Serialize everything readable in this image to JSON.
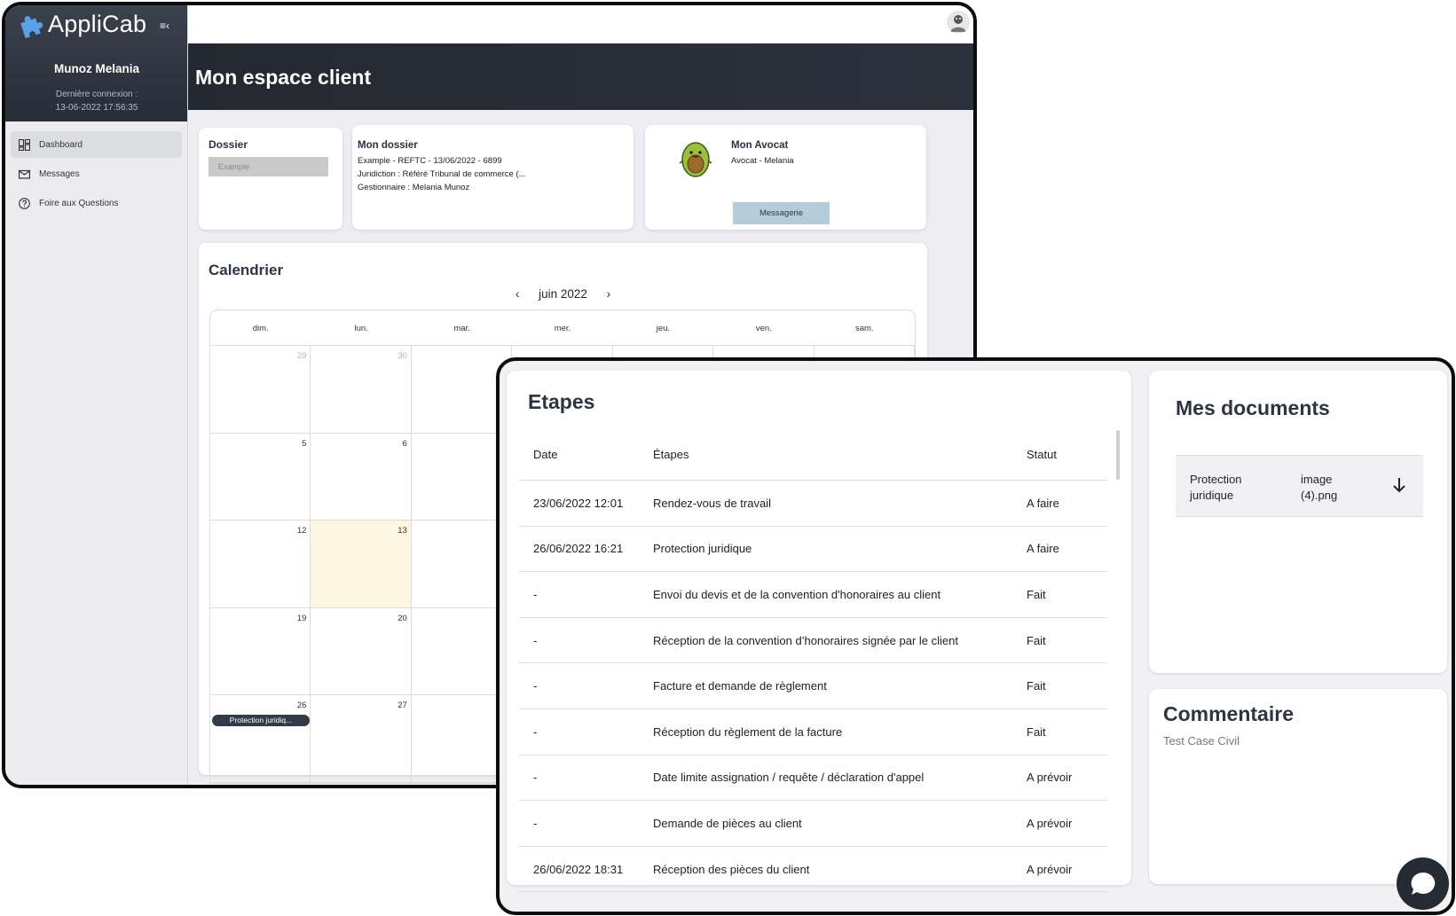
{
  "app": {
    "name": "AppliCab"
  },
  "user": {
    "name": "Munoz Melania",
    "last_login_label": "Dernière connexion :",
    "last_login_value": "13-06-2022 17:56:35"
  },
  "nav": {
    "items": [
      {
        "label": "Dashboard",
        "icon": "dashboard-icon",
        "active": true
      },
      {
        "label": "Messages",
        "icon": "mail-icon",
        "active": false
      },
      {
        "label": "Foire aux Questions",
        "icon": "help-circle-icon",
        "active": false
      }
    ]
  },
  "header": {
    "title": "Mon espace client"
  },
  "dossier": {
    "title": "Dossier",
    "selected": "Example"
  },
  "mon_dossier": {
    "title": "Mon dossier",
    "line1": "Example - REFTC - 13/06/2022 - 6899",
    "line2": "Juridiction : Référé Tribunal de commerce (...",
    "line3": "Gestionnaire : Melania Munoz"
  },
  "avocat": {
    "title": "Mon Avocat",
    "name": "Avocat - Melania",
    "button": "Messagerie"
  },
  "calendar": {
    "title": "Calendrier",
    "month": "juin 2022",
    "prev": "‹",
    "next": "›",
    "days": [
      "dim.",
      "lun.",
      "mar.",
      "mer.",
      "jeu.",
      "ven.",
      "sam."
    ],
    "weeks": [
      [
        "29",
        "30",
        "",
        "",
        "",
        "",
        ""
      ],
      [
        "5",
        "6",
        "",
        "",
        "",
        "",
        ""
      ],
      [
        "12",
        "13",
        "",
        "",
        "",
        "",
        ""
      ],
      [
        "19",
        "20",
        "",
        "",
        "",
        "",
        ""
      ],
      [
        "26",
        "27",
        "",
        "",
        "",
        "",
        ""
      ]
    ],
    "event": "Protection juridiq..."
  },
  "etapes": {
    "title": "Etapes",
    "columns": [
      "Date",
      "Étapes",
      "Statut"
    ],
    "rows": [
      [
        "23/06/2022 12:01",
        "Rendez-vous de travail",
        "A faire"
      ],
      [
        "26/06/2022 16:21",
        "Protection juridique",
        "A faire"
      ],
      [
        "-",
        "Envoi du devis et de la convention d'honoraires au client",
        "Fait"
      ],
      [
        "-",
        "Réception de la convention d’honoraires signée par le client",
        "Fait"
      ],
      [
        "-",
        "Facture et demande de règlement",
        "Fait"
      ],
      [
        "-",
        "Réception du règlement de la facture",
        "Fait"
      ],
      [
        "-",
        "Date limite assignation / requête / déclaration d'appel",
        "A prévoir"
      ],
      [
        "-",
        "Demande de pièces au client",
        "A prévoir"
      ],
      [
        "26/06/2022 18:31",
        "Réception des pièces du client",
        "A prévoir"
      ]
    ]
  },
  "documents": {
    "title": "Mes documents",
    "items": [
      {
        "name": "Protection juridique",
        "file": "image (4).png"
      }
    ]
  },
  "commentaire": {
    "title": "Commentaire",
    "text": "Test Case Civil"
  },
  "colors": {
    "sidebar_header": "#2b313a",
    "header_band": "#272d35",
    "accent_button": "#b4cdd9",
    "today": "#fdf7e2"
  }
}
